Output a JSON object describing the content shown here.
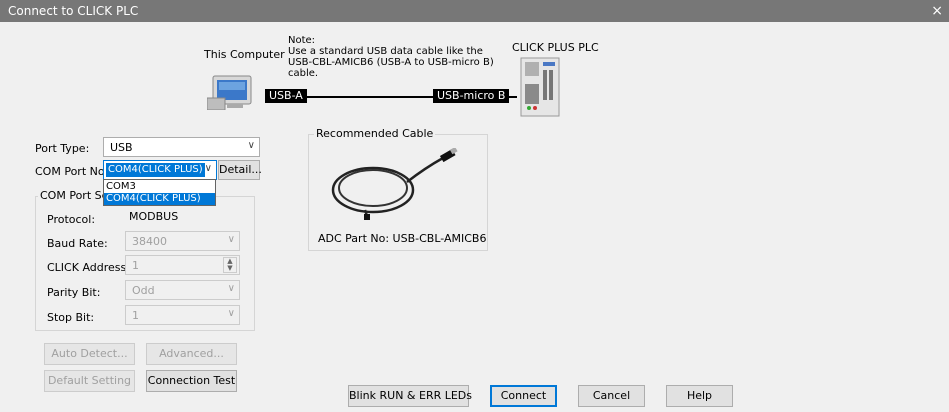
{
  "window": {
    "title": "Connect to CLICK PLC",
    "close_glyph": "×"
  },
  "diagram": {
    "this_computer": "This Computer",
    "note": "Note:\nUse a standard USB data cable like the\nUSB-CBL-AMICB6 (USB-A to USB-micro B)\ncable.",
    "plc_label": "CLICK PLUS PLC",
    "usb_a": "USB-A",
    "usb_micro": "USB-micro B"
  },
  "form": {
    "port_type_label": "Port Type:",
    "port_type_value": "USB",
    "com_port_label": "COM Port No:",
    "com_port_value": "COM4(CLICK PLUS)",
    "detail_button": "Detail...",
    "com_options": [
      "COM3",
      "COM4(CLICK PLUS)"
    ],
    "settings_group_label": "COM Port Set",
    "protocol_label": "Protocol:",
    "protocol_value": "MODBUS",
    "baud_label": "Baud Rate:",
    "baud_value": "38400",
    "address_label": "CLICK Address:",
    "address_value": "1",
    "parity_label": "Parity Bit:",
    "parity_value": "Odd",
    "stop_label": "Stop Bit:",
    "stop_value": "1"
  },
  "cable": {
    "group_label": "Recommended Cable",
    "part_no": "ADC Part No: USB-CBL-AMICB6"
  },
  "buttons": {
    "auto_detect": "Auto Detect...",
    "advanced": "Advanced...",
    "default_setting": "Default Setting",
    "connection_test": "Connection Test",
    "blink": "Blink RUN & ERR LEDs",
    "connect": "Connect",
    "cancel": "Cancel",
    "help": "Help"
  },
  "colors": {
    "titlebar": "#777777",
    "selection": "#0078d7",
    "background": "#f0f0f0"
  }
}
